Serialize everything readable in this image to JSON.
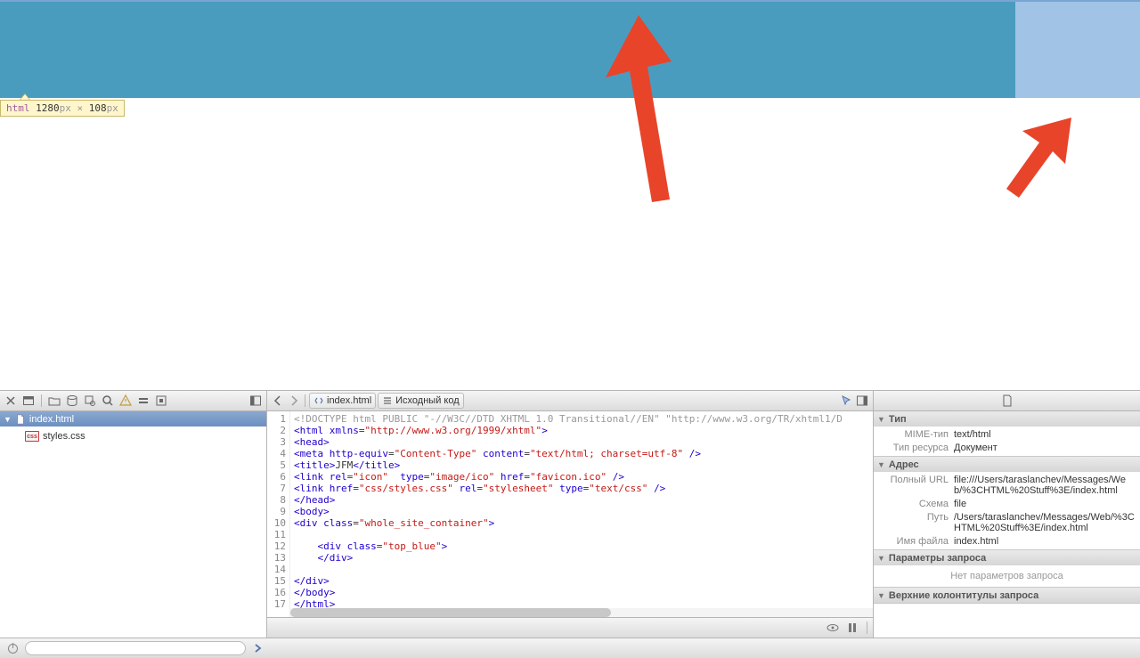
{
  "tooltip": {
    "tag": "html",
    "w": "1280",
    "h": "108",
    "px": "px",
    "times": "×"
  },
  "nav": {
    "header_file": "index.html",
    "child_file": "styles.css"
  },
  "breadcrumb": {
    "file": "index.html",
    "source_label": "Исходный код"
  },
  "code": {
    "lines": [
      1,
      2,
      3,
      4,
      5,
      6,
      7,
      8,
      9,
      10,
      11,
      12,
      13,
      14,
      15,
      16,
      17
    ]
  },
  "status": {},
  "details": {
    "type_section": "Тип",
    "mime_k": "MIME-тип",
    "mime_v": "text/html",
    "restype_k": "Тип ресурса",
    "restype_v": "Документ",
    "addr_section": "Адрес",
    "url_k": "Полный URL",
    "url_v": "file:///Users/taraslanchev/Messages/Web/%3CHTML%20Stuff%3E/index.html",
    "scheme_k": "Схема",
    "scheme_v": "file",
    "path_k": "Путь",
    "path_v": "/Users/taraslanchev/Messages/Web/%3CHTML%20Stuff%3E/index.html",
    "fname_k": "Имя файла",
    "fname_v": "index.html",
    "req_section": "Параметры запроса",
    "req_note": "Нет параметров запроса",
    "hdr_section": "Верхние колонтитулы запроса"
  }
}
